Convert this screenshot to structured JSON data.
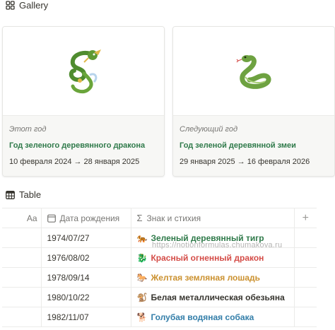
{
  "gallery": {
    "title": "Gallery",
    "cards": [
      {
        "caption": "Этот год",
        "title": "Год зеленого деревянного дракона",
        "dates": "10 февраля 2024 → 28 января 2025",
        "cover_icon": "dragon-icon"
      },
      {
        "caption": "Следующий год",
        "title": "Год зеленой деревянной змеи",
        "dates": "29 января 2025 → 16 февраля 2026",
        "cover_icon": "snake-icon"
      }
    ]
  },
  "table": {
    "title": "Table",
    "columns": {
      "aa": "Aa",
      "date": "Дата рождения",
      "sign": "Знак и стихия",
      "add": "+"
    },
    "rows": [
      {
        "date": "1974/07/27",
        "emoji": "🐅",
        "sign": "Зеленый деревянный тигр",
        "color": "#2f7a4a"
      },
      {
        "date": "1976/08/02",
        "emoji": "🐉",
        "sign": "Красный огненный дракон",
        "color": "#d44c47"
      },
      {
        "date": "1978/09/14",
        "emoji": "🐎",
        "sign": "Желтая земляная лошадь",
        "color": "#cb912f"
      },
      {
        "date": "1980/10/22",
        "emoji": "🐒",
        "sign": "Белая металлическая обезьяна",
        "color": "#37352f"
      },
      {
        "date": "1982/11/07",
        "emoji": "🐕",
        "sign": "Голубая водяная собака",
        "color": "#337ea9"
      }
    ]
  },
  "watermark": "https://notionformulas.chumakova.ru"
}
